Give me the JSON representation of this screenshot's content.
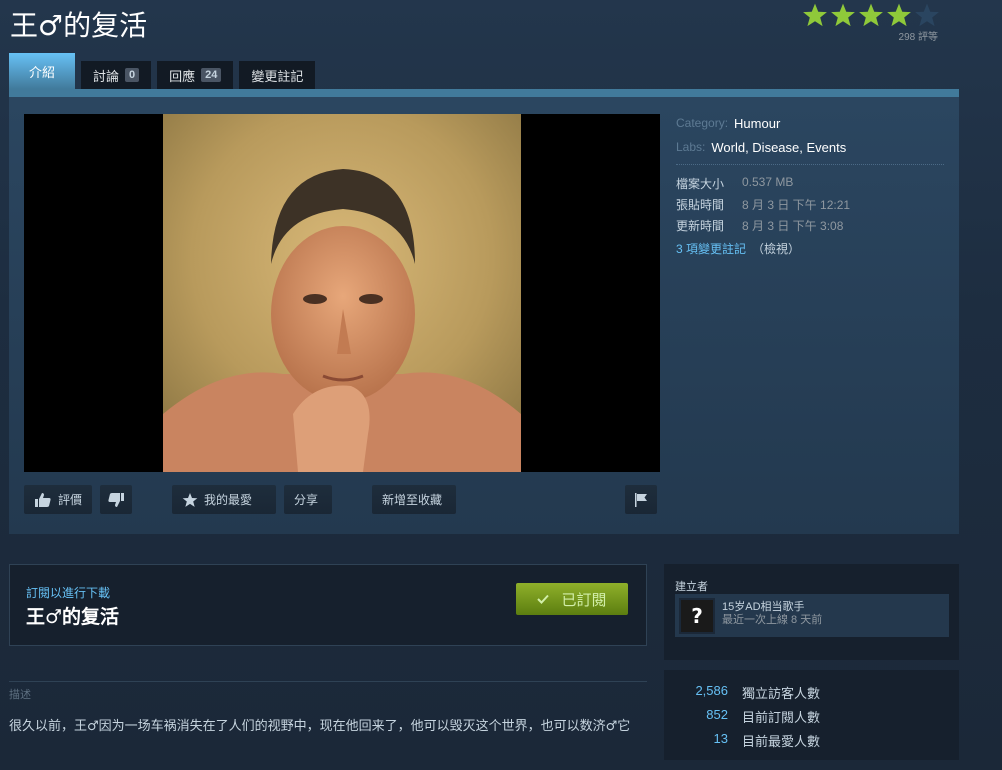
{
  "title": "王♂的复活",
  "rating": {
    "stars_filled": 4,
    "stars_total": 5,
    "count_text": "298 評等",
    "star_color": "#8fc93a",
    "empty_star_color": "#2a4560"
  },
  "tabs": [
    {
      "label": "介紹",
      "active": true
    },
    {
      "label": "討論",
      "count": "0"
    },
    {
      "label": "回應",
      "count": "24"
    },
    {
      "label": "變更註記"
    }
  ],
  "meta": {
    "category_label": "Category:",
    "category_value": "Humour",
    "labs_label": "Labs:",
    "labs_value": "World, Disease, Events",
    "details": [
      {
        "label": "檔案大小",
        "value": "0.537 MB"
      },
      {
        "label": "張貼時間",
        "value": "8 月 3 日 下午 12:21"
      },
      {
        "label": "更新時間",
        "value": "8 月 3 日 下午 3:08"
      }
    ],
    "changes_link": "3 項變更註記",
    "changes_view": "（檢視）"
  },
  "actions": {
    "rate": "評價",
    "favorite": "我的最愛",
    "share": "分享",
    "add_collection": "新增至收藏"
  },
  "subscribe": {
    "label": "訂閱以進行下載",
    "title": "王♂的复活",
    "button": "已訂閱"
  },
  "creator": {
    "label": "建立者",
    "avatar_char": "?",
    "name": "15岁AD相当歌手",
    "status": "最近一次上線 8 天前"
  },
  "stats": [
    {
      "value": "2,586",
      "label": "獨立訪客人數"
    },
    {
      "value": "852",
      "label": "目前訂閱人數"
    },
    {
      "value": "13",
      "label": "目前最愛人數"
    }
  ],
  "description": {
    "label": "描述",
    "text": "很久以前，王♂因为一场车祸消失在了人们的视野中，现在他回来了，他可以毁灭这个世界，也可以数济♂它"
  }
}
